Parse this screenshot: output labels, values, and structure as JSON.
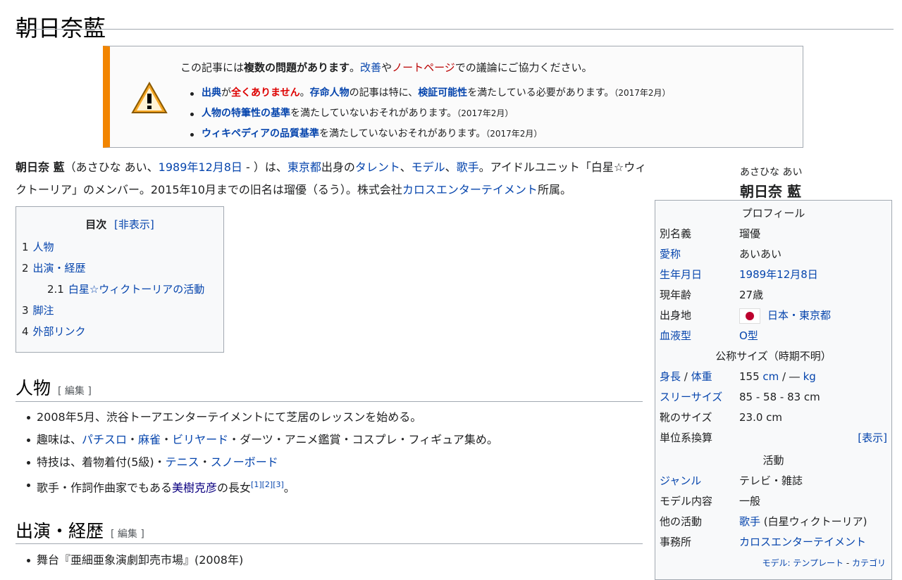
{
  "title": "朝日奈藍",
  "ambox": {
    "intro_1": "この記事には",
    "intro_bold": "複数の問題があります",
    "intro_2": "。",
    "intro_link1": "改善",
    "intro_3": "や",
    "intro_link2": "ノートページ",
    "intro_4": "での議論にご協力ください。",
    "item1": {
      "a": "出典",
      "b": "が",
      "c": "全くありません",
      "d": "。",
      "e": "存命人物",
      "f": "の記事は特に、",
      "g": "検証可能性",
      "h": "を満たしている必要があります。",
      "date": "（2017年2月）"
    },
    "item2": {
      "a": "人物の特筆性の基準",
      "b": "を満たしていないおそれがあります。",
      "date": "（2017年2月）"
    },
    "item3": {
      "a": "ウィキペディアの品質基準",
      "b": "を満たしていないおそれがあります。",
      "date": "（2017年2月）"
    }
  },
  "lead": {
    "name": "朝日奈 藍",
    "p1": "（あさひな あい、",
    "birth": "1989年12月8日",
    "p2": " - ）は、",
    "pref": "東京都",
    "p3": "出身の",
    "talent": "タレント",
    "sep1": "、",
    "model": "モデル",
    "sep2": "、",
    "singer": "歌手",
    "p4": "。アイドルユニット「白星☆ウィクトーリア」のメンバー。2015年10月までの旧名は瑠優（るう）。株式会社",
    "agency": "カロスエンターテイメント",
    "p5": "所属。"
  },
  "toc": {
    "title": "目次",
    "toggle": "[非表示]",
    "items": [
      {
        "num": "1",
        "label": "人物"
      },
      {
        "num": "2",
        "label": "出演・経歴"
      },
      {
        "num": "2.1",
        "label": "白星☆ウィクトーリアの活動"
      },
      {
        "num": "3",
        "label": "脚注"
      },
      {
        "num": "4",
        "label": "外部リンク"
      }
    ]
  },
  "section1": {
    "heading": "人物",
    "edit": "[ 編集 ]",
    "b1": "2008年5月、渋谷トーアエンターテイメントにて芝居のレッスンを始める。",
    "b2_pre": "趣味は、",
    "b2_l1": "パチスロ",
    "b2_s1": "・",
    "b2_l2": "麻雀",
    "b2_s2": "・",
    "b2_l3": "ビリヤード",
    "b2_post": "・ダーツ・アニメ鑑賞・コスプレ・フィギュア集め。",
    "b3_pre": "特技は、着物着付(5級)・",
    "b3_l1": "テニス",
    "b3_s1": "・",
    "b3_l2": "スノーボード",
    "b4_pre": "歌手・作詞作曲家でもある",
    "b4_link": "美樹克彦",
    "b4_post": "の長女",
    "b4_refs": "[1][2][3]",
    "b4_end": "。"
  },
  "section2": {
    "heading": "出演・経歴",
    "edit": "[ 編集 ]",
    "b1": "舞台『亜細亜象演劇卸売市場』(2008年)"
  },
  "infobox": {
    "kana": "あさひな あい",
    "name": "朝日奈 藍",
    "h_profile": "プロフィール",
    "alias_k": "別名義",
    "alias_v": "瑠優",
    "nick_k": "愛称",
    "nick_v": "あいあい",
    "birth_k": "生年月日",
    "birth_v": "1989年12月8日",
    "age_k": "現年齢",
    "age_v": "27歳",
    "origin_k": "出身地",
    "origin_v": "日本・東京都",
    "blood_k": "血液型",
    "blood_v": "O型",
    "h_size": "公称サイズ（時期不明）",
    "height_k1": "身長",
    "height_sep": " / ",
    "height_k2": "体重",
    "height_v1": "155 ",
    "height_u1": "cm",
    "height_v2": " / ― ",
    "height_u2": "kg",
    "three_k": "スリーサイズ",
    "three_v": "85 - 58 - 83 cm",
    "shoe_k": "靴のサイズ",
    "shoe_v": "23.0 cm",
    "unit_k": "単位系換算",
    "unit_v": "[表示]",
    "h_activity": "活動",
    "genre_k": "ジャンル",
    "genre_v": "テレビ・雑誌",
    "modelc_k": "モデル内容",
    "modelc_v": "一般",
    "other_k": "他の活動",
    "other_v1": "歌手",
    "other_v2": " (白星ウィクトーリア)",
    "office_k": "事務所",
    "office_v": "カロスエンターテイメント",
    "foot_a": "モデル: テンプレート",
    "foot_sep": " - ",
    "foot_b": "カテゴリ"
  }
}
